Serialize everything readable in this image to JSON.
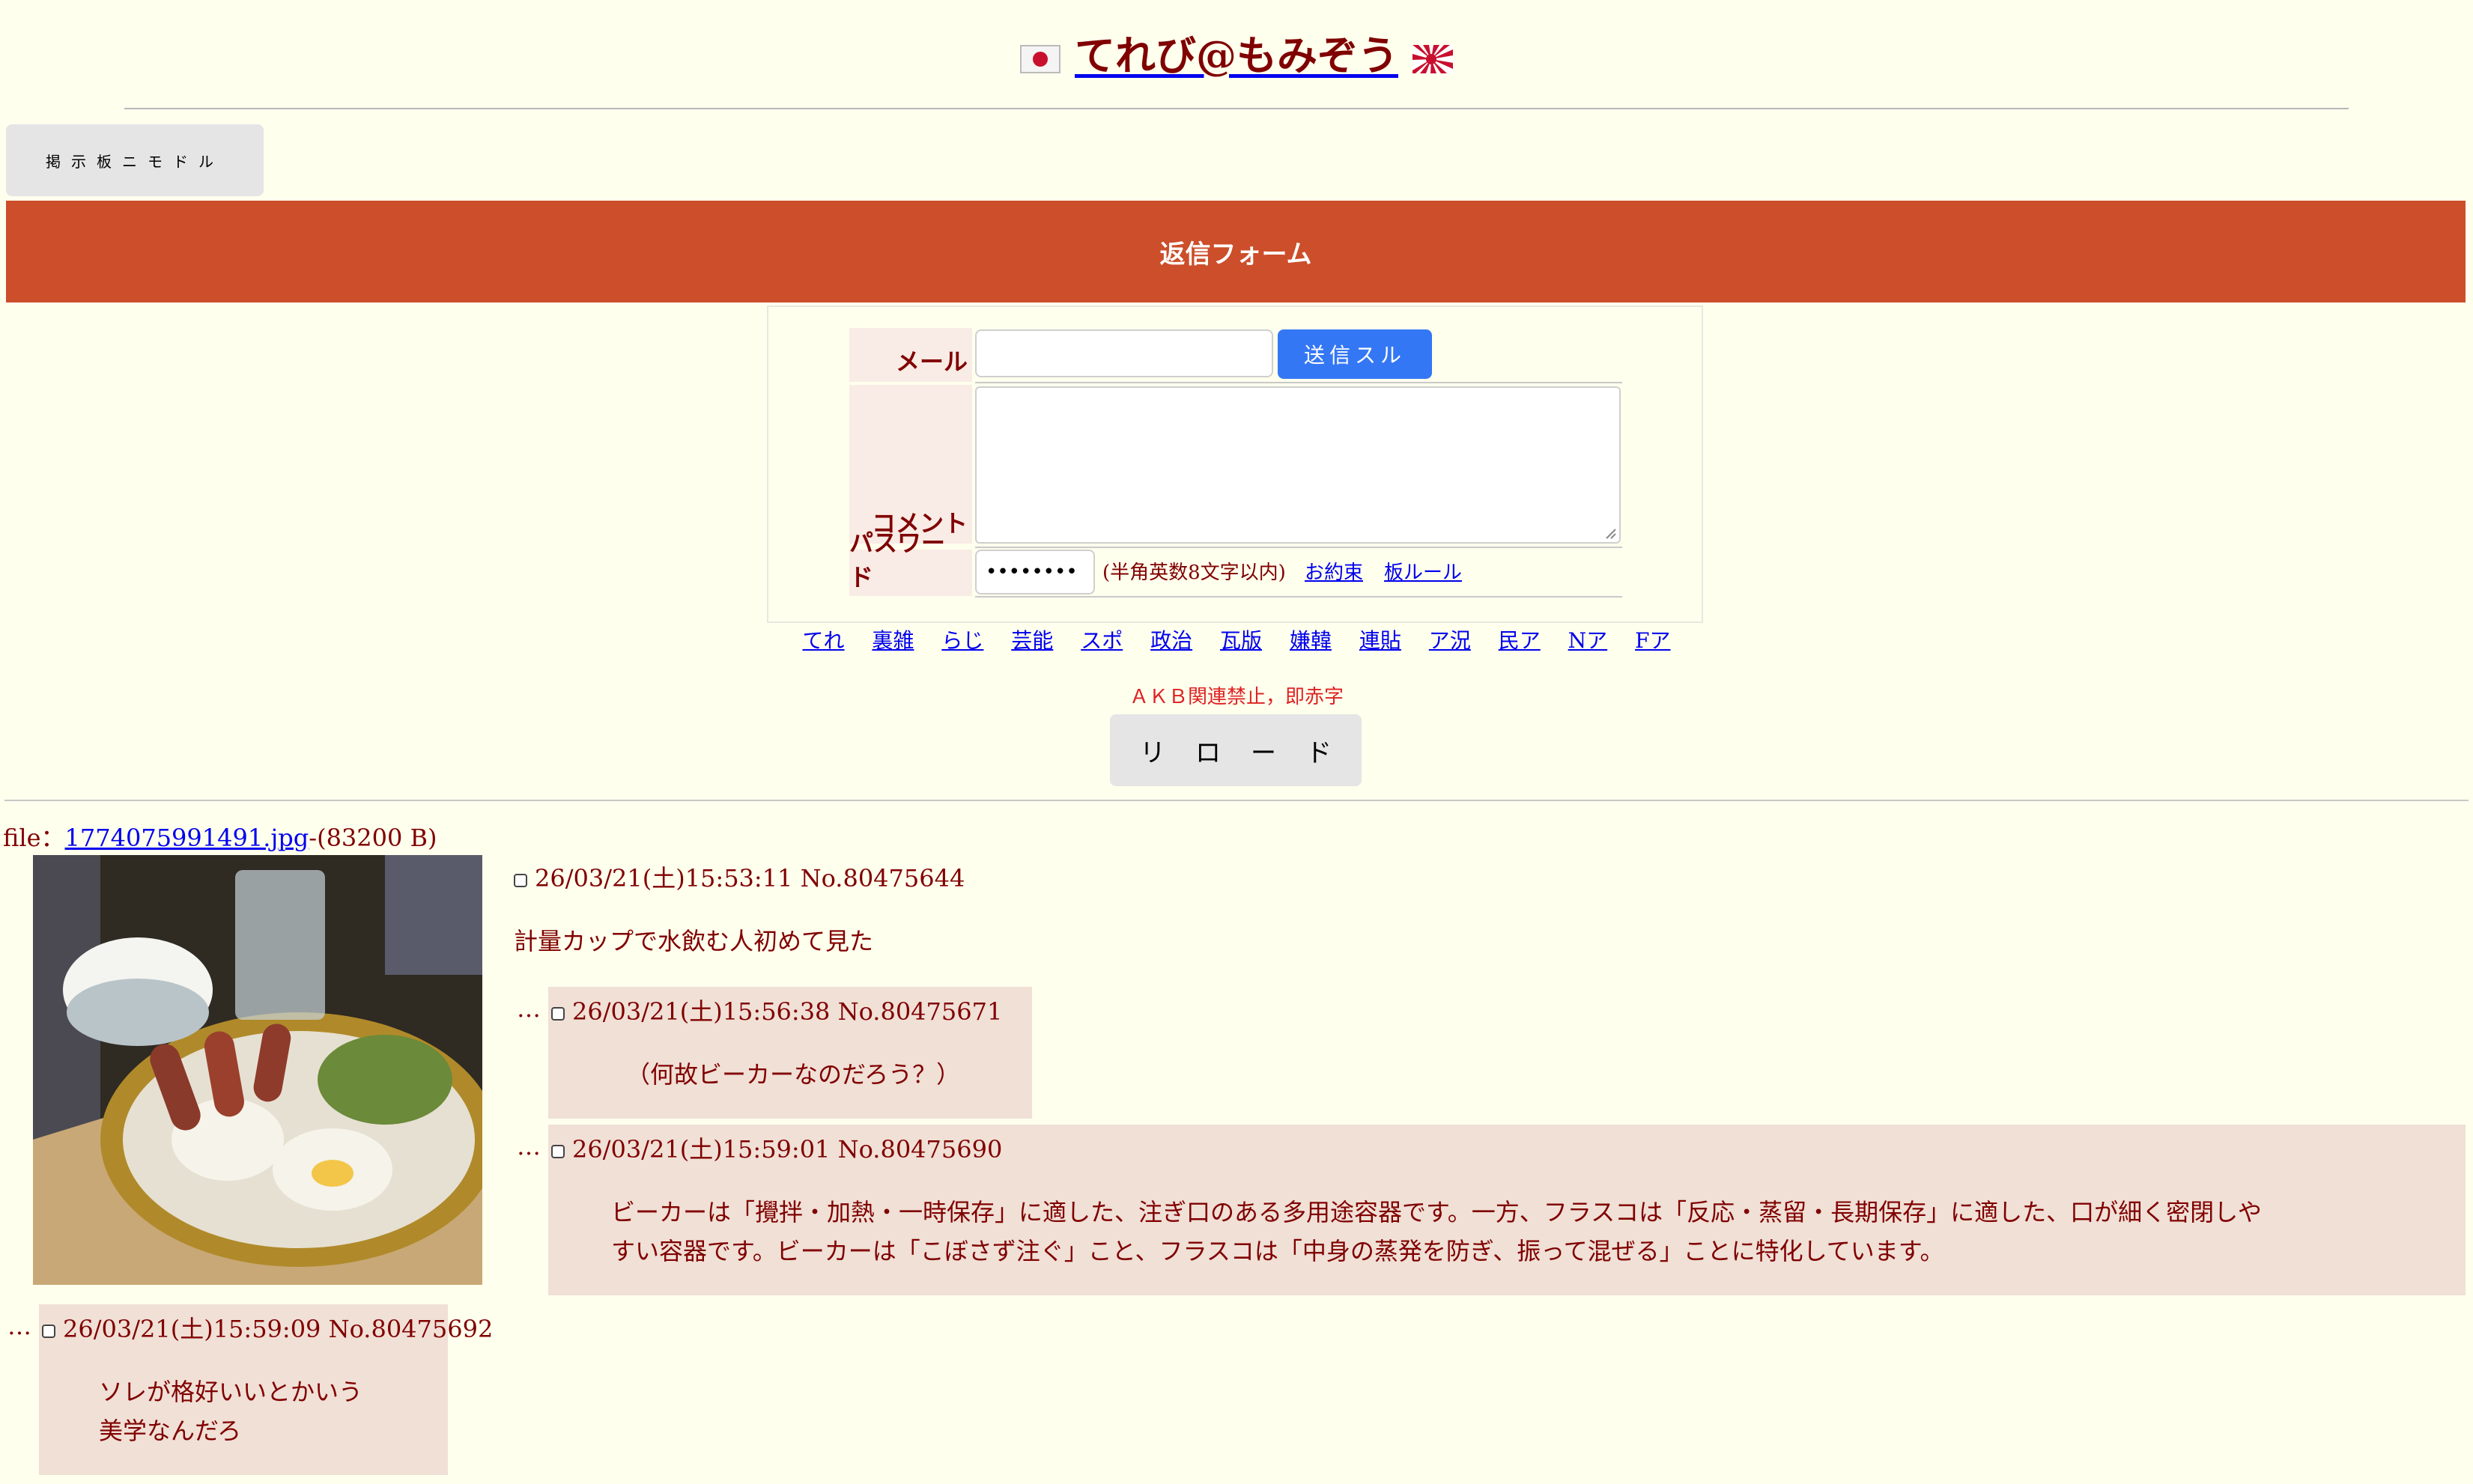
{
  "site": {
    "title": "てれび@もみぞう"
  },
  "nav": {
    "back_label": "掲示板ニモドル"
  },
  "form": {
    "banner": "返信フォーム",
    "mail_label": "メール",
    "mail_value": "",
    "send_label": "送信スル",
    "comment_label": "コメント",
    "comment_value": "",
    "password_label": "パスワード",
    "password_value": "••••••••",
    "password_note": "(半角英数8文字以内)",
    "link_rules": "お約束",
    "link_board_rules": "板ルール"
  },
  "boards": [
    "てれ",
    "裏雑",
    "らじ",
    "芸能",
    "スポ",
    "政治",
    "瓦版",
    "嫌韓",
    "連貼",
    "ア況",
    "民ア",
    "Nア",
    "Fア"
  ],
  "notice": "ＡＫＢ関連禁止，即赤字",
  "reload_label": "リロード",
  "thread": {
    "file_prefix": "file：",
    "file_name": "1774075991491.jpg",
    "file_size": "-(83200 B)",
    "op": {
      "header": "26/03/21(土)15:53:11 No.80475644",
      "body": "計量カップで水飲む人初めて見た"
    },
    "replies": [
      {
        "dots": "…",
        "header": "26/03/21(土)15:56:38 No.80475671",
        "body": [
          "（何故ビーカーなのだろう？）"
        ]
      },
      {
        "dots": "…",
        "header": "26/03/21(土)15:59:01 No.80475690",
        "body": [
          "ビーカーは「攪拌・加熱・一時保存」に適した、注ぎ口のある多用途容器です。一方、フラスコは「反応・蒸留・長期保存」に適した、口が細く密閉しや",
          "すい容器です。ビーカーは「こぼさず注ぐ」こと、フラスコは「中身の蒸発を防ぎ、振って混ぜる」ことに特化しています。"
        ]
      },
      {
        "dots": "…",
        "header": "26/03/21(土)15:59:09 No.80475692",
        "body": [
          "ソレが格好いいとかいう",
          "美学なんだろ"
        ]
      }
    ]
  },
  "colors": {
    "background": "#ffffee",
    "text": "#800000",
    "banner": "#cc4e2a",
    "reply_bg": "#f0e0d6",
    "send_button": "#3477f5",
    "link": "#0000ee"
  }
}
